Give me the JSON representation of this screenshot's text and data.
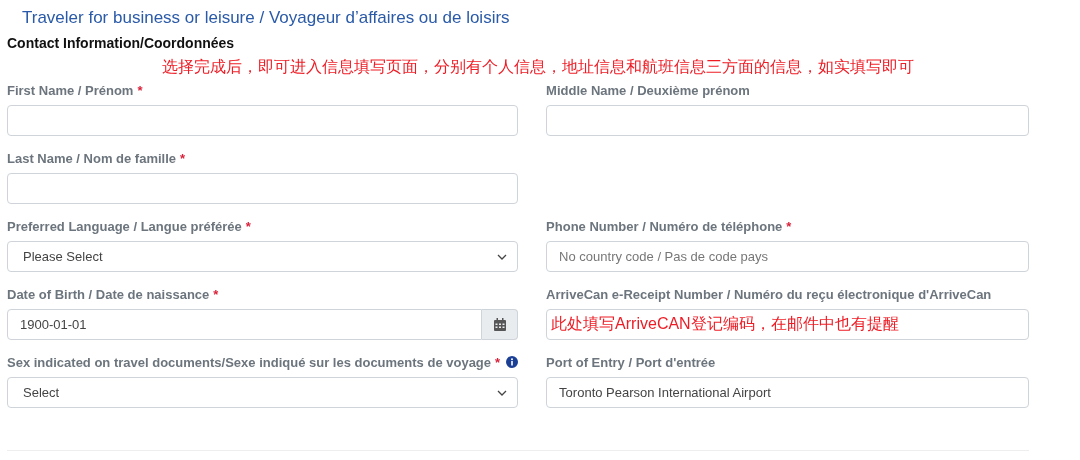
{
  "page_title": "Traveler for business or leisure / Voyageur d’affaires ou de loisirs",
  "section_title": "Contact Information/Coordonnées",
  "annotation": "选择完成后，即可进入信息填写页面，分别有个人信息，地址信息和航班信息三方面的信息，如实填写即可",
  "rows": [
    {
      "fields": [
        {
          "kind": "text",
          "label": "First Name / Prénom",
          "required_mark": "*"
        },
        {
          "kind": "text",
          "label": "Middle Name / Deuxième prénom"
        }
      ]
    },
    {
      "fields": [
        {
          "kind": "text",
          "label": "Last Name / Nom de famille",
          "required_mark": "*"
        }
      ]
    },
    {
      "fields": [
        {
          "kind": "select",
          "label": "Preferred Language / Langue préférée",
          "required_mark": "*",
          "value": "Please Select"
        },
        {
          "kind": "text",
          "label": "Phone Number / Numéro de téléphone",
          "required_mark": "*",
          "placeholder": "No country code / Pas de code pays"
        }
      ]
    },
    {
      "fields": [
        {
          "kind": "date",
          "label": "Date of Birth / Date de naissance",
          "required_mark": "*",
          "value": "1900-01-01"
        },
        {
          "kind": "annotated",
          "label": "ArriveCan e-Receipt Number / Numéro du reçu électronique d'ArriveCan",
          "annotation": "此处填写ArriveCAN登记编码，在邮件中也有提醒"
        }
      ]
    },
    {
      "fields": [
        {
          "kind": "select",
          "label": "Sex indicated on travel documents/Sexe indiqué sur les documents de voyage",
          "required_mark": "*",
          "info": true,
          "value": "Select"
        },
        {
          "kind": "text",
          "label": "Port of Entry / Port d'entrée",
          "value": "Toronto Pearson International Airport"
        }
      ]
    }
  ]
}
